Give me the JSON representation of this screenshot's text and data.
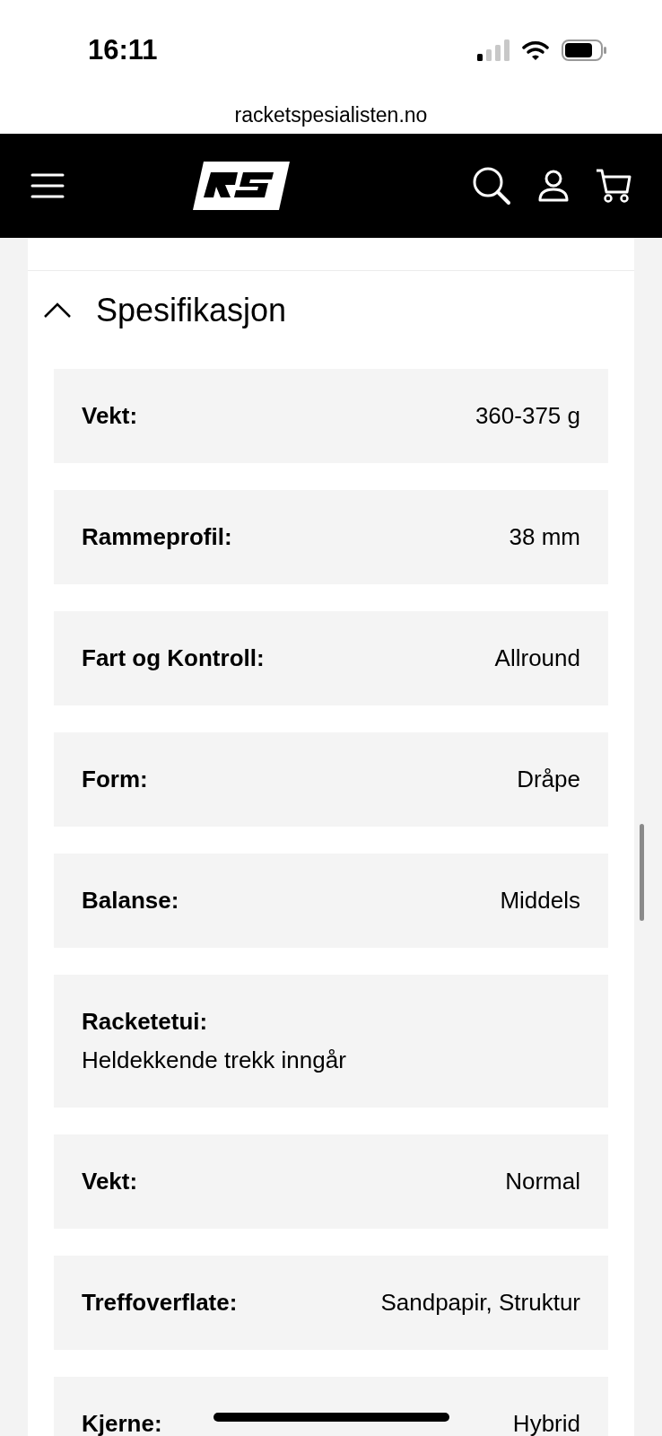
{
  "status_bar": {
    "time": "16:11"
  },
  "browser": {
    "url": "racketspesialisten.no"
  },
  "section": {
    "title": "Spesifikasjon",
    "expanded": true
  },
  "specs": [
    {
      "label": "Vekt:",
      "value": "360-375 g",
      "kind": "inline"
    },
    {
      "label": "Rammeprofil:",
      "value": "38 mm",
      "kind": "inline"
    },
    {
      "label": "Fart og Kontroll:",
      "value": "Allround",
      "kind": "inline"
    },
    {
      "label": "Form:",
      "value": "Dråpe",
      "kind": "inline"
    },
    {
      "label": "Balanse:",
      "value": "Middels",
      "kind": "inline"
    },
    {
      "label": "Racketetui:",
      "value": "Heldekkende trekk inngår",
      "kind": "stacked"
    },
    {
      "label": "Vekt:",
      "value": "Normal",
      "kind": "inline"
    },
    {
      "label": "Treffoverflate:",
      "value": "Sandpapir, Struktur",
      "kind": "inline"
    },
    {
      "label": "Kjerne:",
      "value": "Hybrid",
      "kind": "inline"
    }
  ]
}
